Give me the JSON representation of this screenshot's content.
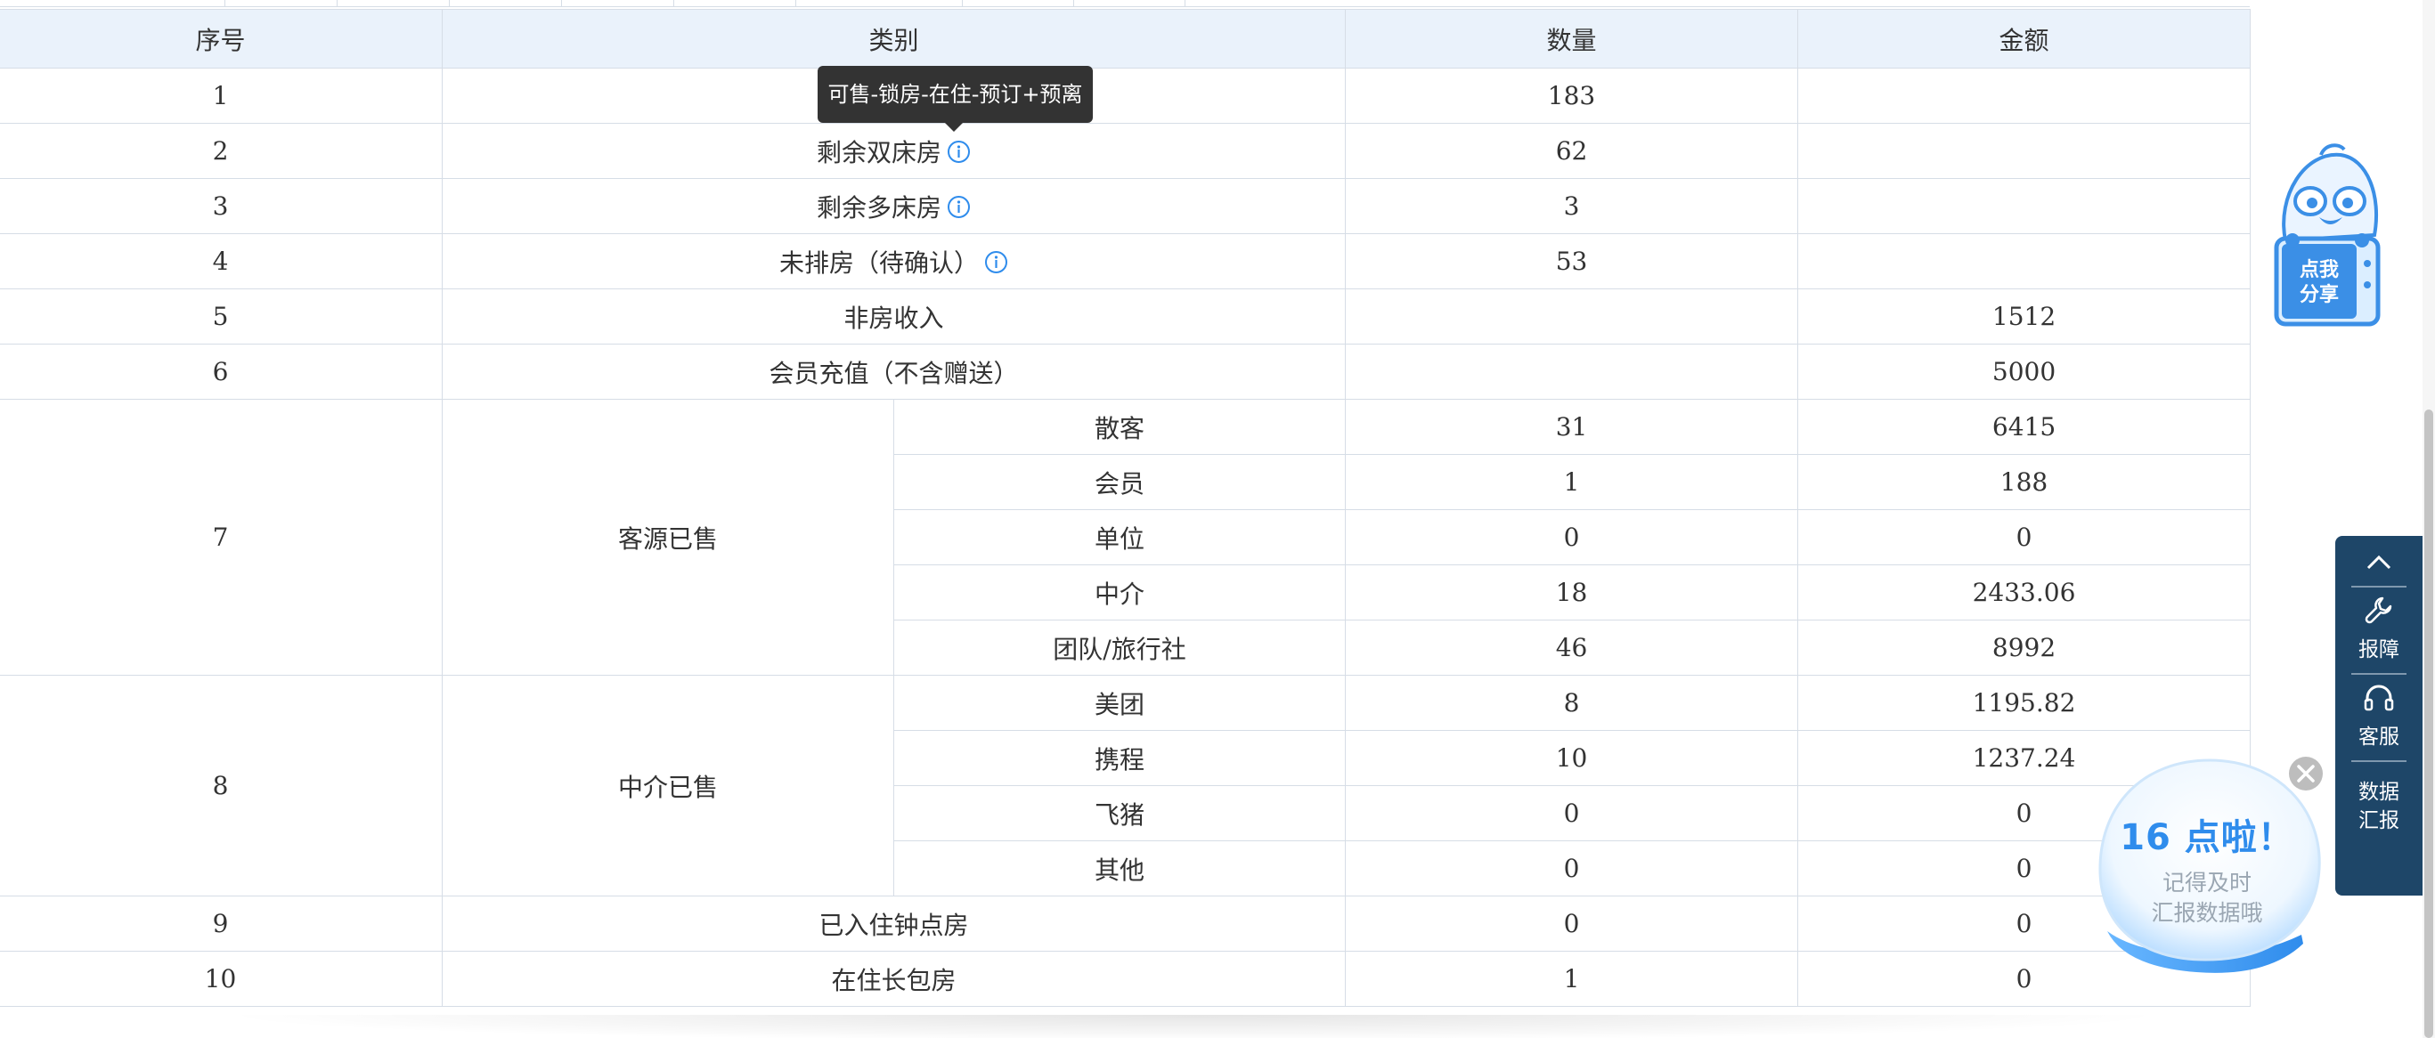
{
  "table": {
    "headers": [
      "序号",
      "类别",
      "数量",
      "金额"
    ],
    "tooltip": "可售-锁房-在住-预订+预离",
    "simple_rows": [
      {
        "no": "1",
        "category": "",
        "qty": "183",
        "amount": ""
      },
      {
        "no": "2",
        "category": "剩余双床房",
        "qty": "62",
        "amount": ""
      },
      {
        "no": "3",
        "category": "剩余多床房",
        "qty": "3",
        "amount": ""
      },
      {
        "no": "4",
        "category": "未排房（待确认）",
        "qty": "53",
        "amount": ""
      },
      {
        "no": "5",
        "category": "非房收入",
        "qty": "",
        "amount": "1512"
      },
      {
        "no": "6",
        "category": "会员充值（不含赠送）",
        "qty": "",
        "amount": "5000"
      }
    ],
    "group_source": {
      "no": "7",
      "category": "客源已售",
      "rows": [
        {
          "sub": "散客",
          "qty": "31",
          "amount": "6415"
        },
        {
          "sub": "会员",
          "qty": "1",
          "amount": "188"
        },
        {
          "sub": "单位",
          "qty": "0",
          "amount": "0"
        },
        {
          "sub": "中介",
          "qty": "18",
          "amount": "2433.06"
        },
        {
          "sub": "团队/旅行社",
          "qty": "46",
          "amount": "8992"
        }
      ]
    },
    "group_agent": {
      "no": "8",
      "category": "中介已售",
      "rows": [
        {
          "sub": "美团",
          "qty": "8",
          "amount": "1195.82"
        },
        {
          "sub": "携程",
          "qty": "10",
          "amount": "1237.24"
        },
        {
          "sub": "飞猪",
          "qty": "0",
          "amount": "0"
        },
        {
          "sub": "其他",
          "qty": "0",
          "amount": "0"
        }
      ]
    },
    "tail_rows": [
      {
        "no": "9",
        "category": "已入住钟点房",
        "qty": "0",
        "amount": "0"
      },
      {
        "no": "10",
        "category": "在住长包房",
        "qty": "1",
        "amount": "0"
      }
    ]
  },
  "share": {
    "label_line1": "点我",
    "label_line2": "分享"
  },
  "side_bar": {
    "report_label": "报障",
    "service_label": "客服",
    "data_label_line1": "数据",
    "data_label_line2": "汇报"
  },
  "reminder": {
    "title": "16 点啦！",
    "line1": "记得及时",
    "line2": "汇报数据哦"
  },
  "colors": {
    "header_bg": "#eaf2fb",
    "border": "#d6dde6",
    "info_icon": "#2f8cec",
    "side_bar_bg": "#1e4668",
    "tooltip_bg": "#333333",
    "reminder_title": "#2f8cec"
  },
  "icons": {
    "info": "info-circle-icon",
    "up": "chevron-up-icon",
    "report": "wrench-icon",
    "service": "headset-icon",
    "close": "close-icon",
    "mascot": "duck-mascot-icon"
  }
}
